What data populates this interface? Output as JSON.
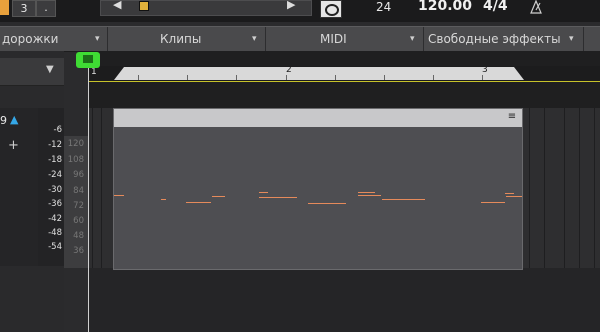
{
  "topbar": {
    "left_num": "3",
    "dot_label": ".",
    "ppq": "24",
    "tempo": "120.00",
    "meter": "4/4"
  },
  "menubar": {
    "tracks": "дорожки",
    "clips": "Клипы",
    "midi": "MIDI",
    "fx": "Свободные эффекты",
    "arrow": "▾"
  },
  "track": {
    "number": "9",
    "up_icon": "▲",
    "plus": "+"
  },
  "db_scale": [
    "-6",
    "-12",
    "-18",
    "-24",
    "-30",
    "-36",
    "-42",
    "-48",
    "-54"
  ],
  "key_scale": [
    "120",
    "108",
    "96",
    "84",
    "72",
    "60",
    "48",
    "36"
  ],
  "ruler": {
    "bars": [
      "1",
      "2",
      "3"
    ]
  },
  "clip": {
    "menu_icon": "≡"
  },
  "colors": {
    "playhead": "#3fdc34",
    "note": "#e58a5b",
    "loop": "#d9d9d9",
    "accent_blue": "#35a8e8",
    "stop_button": "#e2b23b"
  }
}
